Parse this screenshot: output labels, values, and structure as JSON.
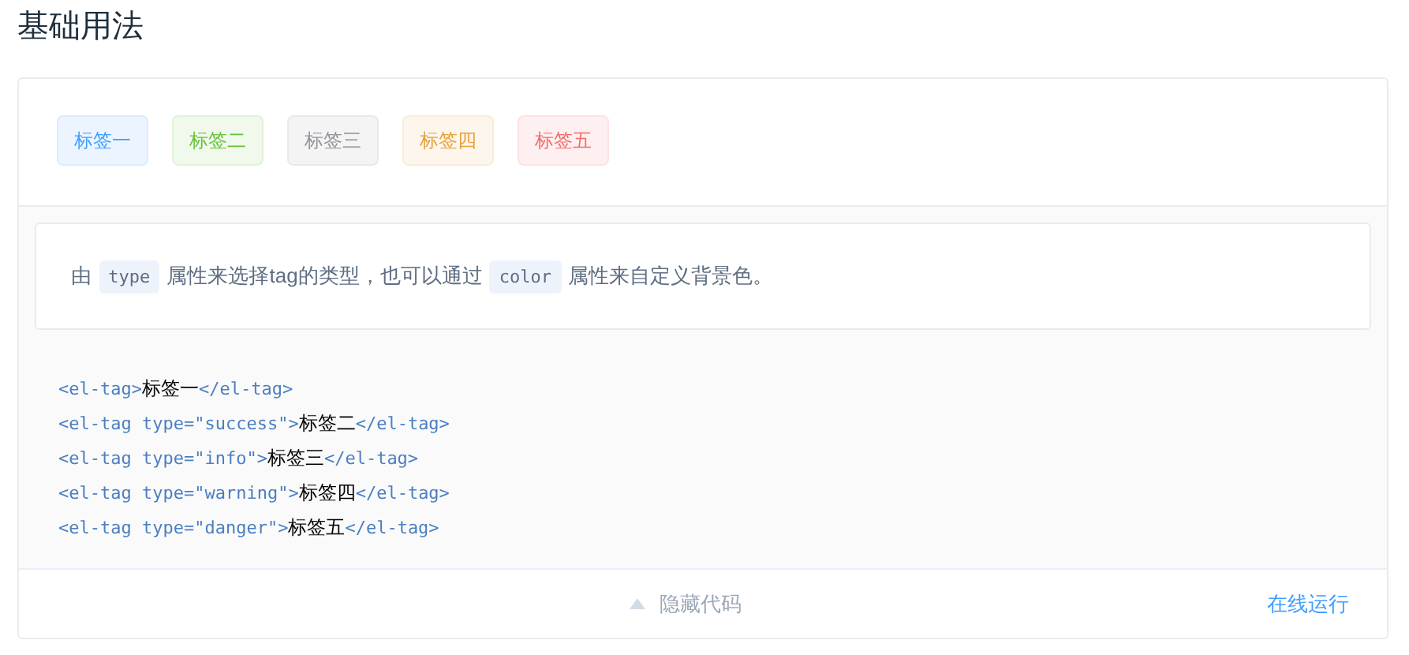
{
  "title": "基础用法",
  "tags": [
    {
      "label": "标签一",
      "color": "#409eff"
    },
    {
      "label": "标签二",
      "color": "#67c23a"
    },
    {
      "label": "标签三",
      "color": "#909399"
    },
    {
      "label": "标签四",
      "color": "#e6a23c"
    },
    {
      "label": "标签五",
      "color": "#f56c6c"
    }
  ],
  "description": [
    {
      "kind": "text",
      "text": "由 "
    },
    {
      "kind": "code",
      "text": "type"
    },
    {
      "kind": "text",
      "text": " 属性来选择tag的类型，也可以通过 "
    },
    {
      "kind": "code",
      "text": "color"
    },
    {
      "kind": "text",
      "text": " 属性来自定义背景色。"
    }
  ],
  "code_lines": [
    [
      {
        "kind": "markup",
        "text": "<el-tag>"
      },
      {
        "kind": "text",
        "text": "标签一"
      },
      {
        "kind": "markup",
        "text": "</el-tag>"
      }
    ],
    [
      {
        "kind": "markup",
        "text": "<el-tag type=\"success\">"
      },
      {
        "kind": "text",
        "text": "标签二"
      },
      {
        "kind": "markup",
        "text": "</el-tag>"
      }
    ],
    [
      {
        "kind": "markup",
        "text": "<el-tag type=\"info\">"
      },
      {
        "kind": "text",
        "text": "标签三"
      },
      {
        "kind": "markup",
        "text": "</el-tag>"
      }
    ],
    [
      {
        "kind": "markup",
        "text": "<el-tag type=\"warning\">"
      },
      {
        "kind": "text",
        "text": "标签四"
      },
      {
        "kind": "markup",
        "text": "</el-tag>"
      }
    ],
    [
      {
        "kind": "markup",
        "text": "<el-tag type=\"danger\">"
      },
      {
        "kind": "text",
        "text": "标签五"
      },
      {
        "kind": "markup",
        "text": "</el-tag>"
      }
    ]
  ],
  "footer": {
    "toggle": "隐藏代码",
    "run": "在线运行"
  }
}
